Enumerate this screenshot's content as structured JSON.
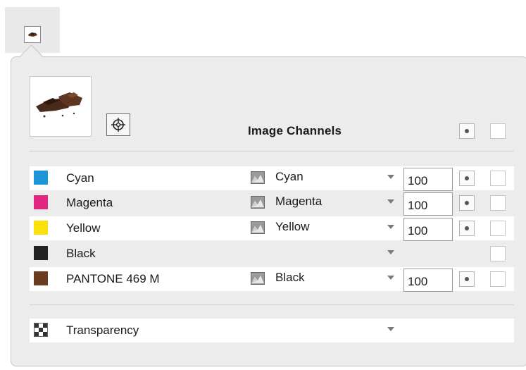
{
  "toolbar": {
    "icon": "chocolate-thumbnail-icon"
  },
  "header": {
    "title": "Image Channels"
  },
  "thumbnail": {
    "icon": "chocolate-image"
  },
  "channels": [
    {
      "name": "Cyan",
      "color": "#1f95d9",
      "source": "Cyan",
      "value": "100",
      "has_source": true,
      "has_value": true,
      "has_radio": true
    },
    {
      "name": "Magenta",
      "color": "#e0267f",
      "source": "Magenta",
      "value": "100",
      "has_source": true,
      "has_value": true,
      "has_radio": true
    },
    {
      "name": "Yellow",
      "color": "#f9e10b",
      "source": "Yellow",
      "value": "100",
      "has_source": true,
      "has_value": true,
      "has_radio": true
    },
    {
      "name": "Black",
      "color": "#222222",
      "source": "",
      "value": "",
      "has_source": false,
      "has_value": false,
      "has_radio": false
    },
    {
      "name": "PANTONE 469 M",
      "color": "#6a3d22",
      "source": "Black",
      "value": "100",
      "has_source": true,
      "has_value": true,
      "has_radio": true
    }
  ],
  "transparency": {
    "name": "Transparency",
    "icon": "checkerboard-icon"
  }
}
